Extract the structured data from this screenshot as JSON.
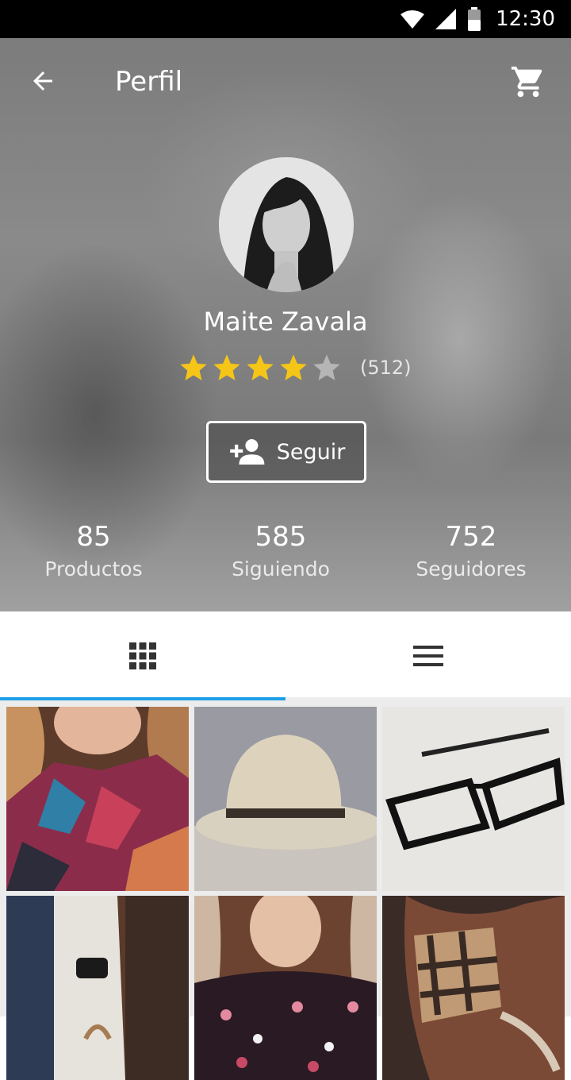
{
  "status_bar": {
    "time": "12:30",
    "icons": [
      "wifi-icon",
      "signal-icon",
      "battery-icon"
    ]
  },
  "header": {
    "title": "Perfil",
    "back_icon": "arrow-back-icon",
    "cart_icon": "shopping-cart-icon"
  },
  "profile": {
    "name": "Maite Zavala",
    "rating": 4,
    "rating_max": 5,
    "rating_count": "(512)",
    "follow_label": "Seguir",
    "follow_icon": "person-add-icon"
  },
  "stats": [
    {
      "value": "85",
      "label": "Productos"
    },
    {
      "value": "585",
      "label": "Siguiendo"
    },
    {
      "value": "752",
      "label": "Seguidores"
    }
  ],
  "tabs": [
    {
      "icon": "grid-view-icon",
      "selected": true
    },
    {
      "icon": "list-view-icon",
      "selected": false
    }
  ],
  "colors": {
    "accent": "#1e9ee6",
    "star": "#f5c518",
    "star_empty": "#b5b5b5"
  },
  "products": [
    {
      "name": "poncho"
    },
    {
      "name": "hat"
    },
    {
      "name": "glasses"
    },
    {
      "name": "watch"
    },
    {
      "name": "floral-dress"
    },
    {
      "name": "plaid-scarf"
    }
  ]
}
